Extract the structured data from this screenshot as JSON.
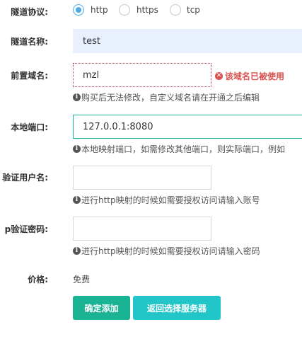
{
  "tunnel_protocol": {
    "label": "隧道协议:",
    "options": [
      "http",
      "https",
      "tcp"
    ],
    "selected": "http"
  },
  "tunnel_name": {
    "label": "隧道名称:",
    "value": "test"
  },
  "front_domain": {
    "label": "前置域名:",
    "value": "mzl",
    "error": "该域名已被使用",
    "help": "购买后无法修改，自定义域名请在开通之后编辑"
  },
  "local_port": {
    "label": "本地端口:",
    "value": "127.0.0.1:8080",
    "help": "本地映射端口，如需修改其他端口，则实际端口，例如"
  },
  "auth_user": {
    "label": "验证用户名:",
    "value": "",
    "help": "进行http映射的时候如需要授权访问请输入账号"
  },
  "auth_password": {
    "label": "p验证密码:",
    "value": "",
    "help": "进行http映射的时候如需要授权访问请输入密码"
  },
  "price": {
    "label": "价格:",
    "value": "免费"
  },
  "actions": {
    "confirm": "确定添加",
    "back": "返回选择服务器"
  },
  "colors": {
    "radio_accent": "#4aa9e8",
    "error": "#d9534f",
    "confirm": "#1ab394",
    "back": "#23c6c8"
  }
}
